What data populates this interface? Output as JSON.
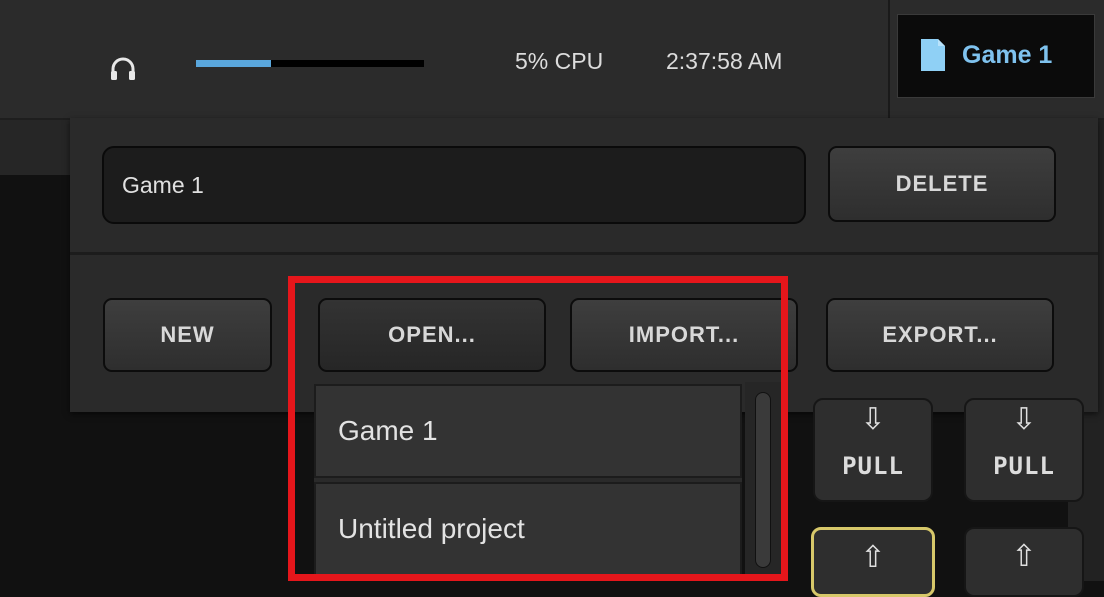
{
  "status_bar": {
    "headphones_icon": "headphones-icon",
    "volume_level": 0.33,
    "cpu_text": "5% CPU",
    "time_text": "2:37:58 AM"
  },
  "project_tab": {
    "icon": "document-icon",
    "name": "Game 1"
  },
  "project_panel": {
    "name_value": "Game 1",
    "delete_label": "DELETE",
    "new_label": "NEW",
    "open_label": "OPEN...",
    "import_label": "IMPORT...",
    "export_label": "EXPORT...",
    "files": [
      "Game 1",
      "Untitled project"
    ]
  },
  "transition_buttons": {
    "pull_label": "PULL",
    "pull_icon": "arrow-down-icon",
    "push_icon": "arrow-up-icon"
  },
  "colors": {
    "accent": "#5aa7dd",
    "highlight": "#e5161b",
    "tab_text": "#7fc2ee",
    "push_border": "#d7c86a"
  }
}
